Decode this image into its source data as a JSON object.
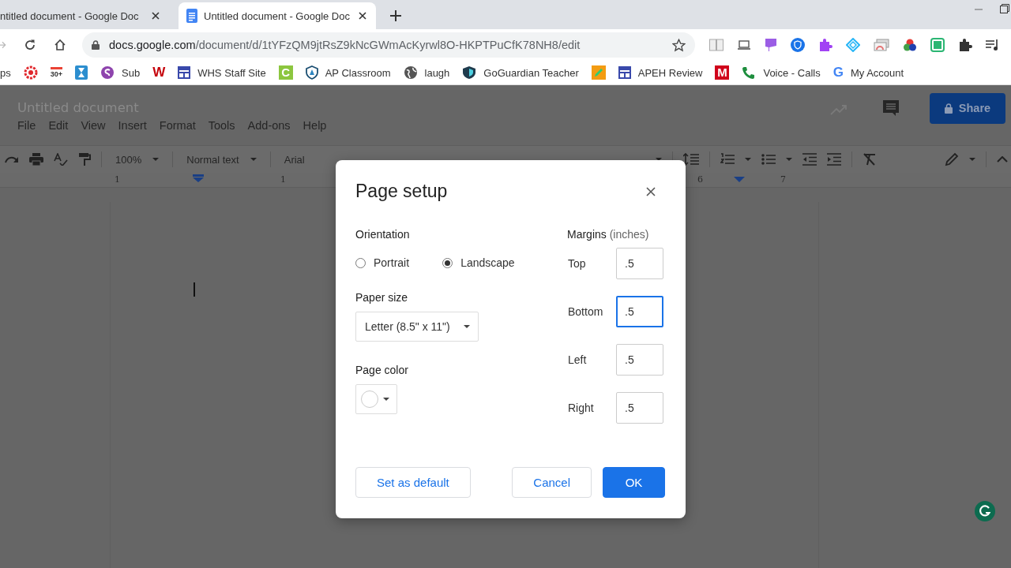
{
  "browser": {
    "tabs": [
      {
        "title": "ntitled document - Google Doc",
        "selected": false
      },
      {
        "title": "Untitled document - Google Doc",
        "selected": true
      }
    ],
    "url": {
      "host": "docs.google.com",
      "path": "/document/d/1tYFzQM9jtRsZ9kNcGWmAcKyrwl8O-HKPTPuCfK78NH8/edit"
    },
    "bookmarks": [
      {
        "kind": "text",
        "label": "ps"
      },
      {
        "kind": "ring"
      },
      {
        "kind": "mail",
        "glyph": "30+"
      },
      {
        "kind": "hourglass"
      },
      {
        "kind": "swirl",
        "label": "Sub"
      },
      {
        "kind": "letter",
        "glyph": "W",
        "color": "#c5050c"
      },
      {
        "kind": "layout",
        "label": "WHS Staff Site"
      },
      {
        "kind": "tile",
        "glyph": "C",
        "color": "#8cc63f"
      },
      {
        "kind": "shield",
        "label": "AP Classroom"
      },
      {
        "kind": "globe",
        "label": "laugh"
      },
      {
        "kind": "shield-dark",
        "label": "GoGuardian Teacher"
      },
      {
        "kind": "pencil"
      },
      {
        "kind": "layout",
        "label": "APEH Review"
      },
      {
        "kind": "tile",
        "glyph": "M",
        "color": "#d0021b"
      },
      {
        "kind": "phone",
        "label": "Voice - Calls"
      },
      {
        "kind": "letter",
        "glyph": "G",
        "color": "#4285f4",
        "label": "My Account"
      }
    ]
  },
  "docs": {
    "title": "Untitled document",
    "menus": [
      "File",
      "Edit",
      "View",
      "Insert",
      "Format",
      "Tools",
      "Add-ons",
      "Help"
    ],
    "share": "Share",
    "zoom": "100%",
    "style": "Normal text",
    "font": "Arial",
    "ruler": [
      "1",
      "1",
      "6",
      "7"
    ]
  },
  "dialog": {
    "title": "Page setup",
    "orientation": {
      "label": "Orientation",
      "options": [
        {
          "label": "Portrait",
          "selected": false
        },
        {
          "label": "Landscape",
          "selected": true
        }
      ]
    },
    "paper_size": {
      "label": "Paper size",
      "value": "Letter (8.5\" x 11\")"
    },
    "page_color": {
      "label": "Page color"
    },
    "margins": {
      "label": "Margins",
      "unit": "(inches)",
      "fields": [
        {
          "label": "Top",
          "value": ".5",
          "focused": false
        },
        {
          "label": "Bottom",
          "value": ".5",
          "focused": true
        },
        {
          "label": "Left",
          "value": ".5",
          "focused": false
        },
        {
          "label": "Right",
          "value": ".5",
          "focused": false
        }
      ]
    },
    "buttons": {
      "default": "Set as default",
      "cancel": "Cancel",
      "ok": "OK"
    }
  }
}
